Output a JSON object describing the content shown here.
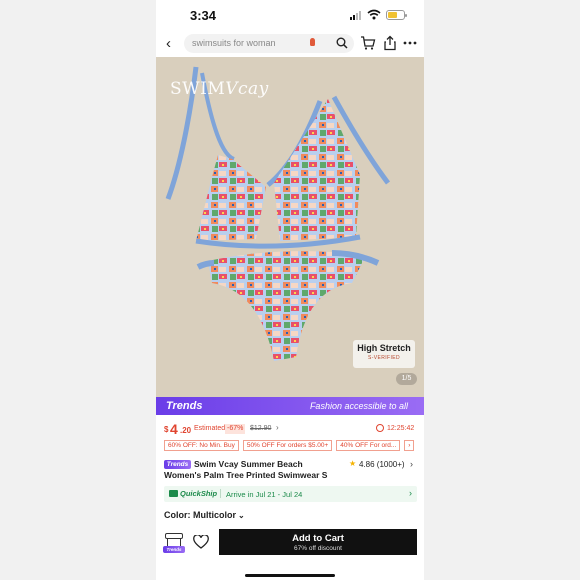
{
  "status_bar": {
    "time": "3:34"
  },
  "search": {
    "placeholder": "swimsuits for woman"
  },
  "hero": {
    "brand": "SWIM",
    "brand_script": "Vcay",
    "badge_title": "High Stretch",
    "badge_sub": "S-VERIFIED",
    "pager": "1/5",
    "background": "#d9cfbd"
  },
  "trends_banner": {
    "logo": "Trends",
    "tagline": "Fashion accessible to all",
    "color": "#7a4ff0"
  },
  "price": {
    "currency": "$",
    "integer": "4",
    "decimal": ".20",
    "estimated": "Estimated",
    "discount": "-67%",
    "original": "$12.90",
    "chevron": "›",
    "countdown": "12:25:42",
    "color": "#e0442f"
  },
  "coupons": [
    "60% OFF: No Min. Buy",
    "50% OFF For orders $5.00+",
    "40% OFF For ord...",
    "›"
  ],
  "product": {
    "trends_badge": "Trends",
    "title_line1": "Swim Vcay Summer Beach",
    "title_line2": "Women's Palm Tree Printed Swimwear S",
    "rating": "4.86 (1000+)",
    "star": "★",
    "chevron": "›"
  },
  "shipping": {
    "label": "QuickShip",
    "arrival": "Arrive in Jul 21 - Jul 24",
    "chevron": "›"
  },
  "color_option": {
    "label": "Color: Multicolor",
    "chevron": "⌄"
  },
  "bottom_bar": {
    "store_badge": "Trends",
    "cart_label": "Add to Cart",
    "cart_sub": "67% off discount"
  }
}
